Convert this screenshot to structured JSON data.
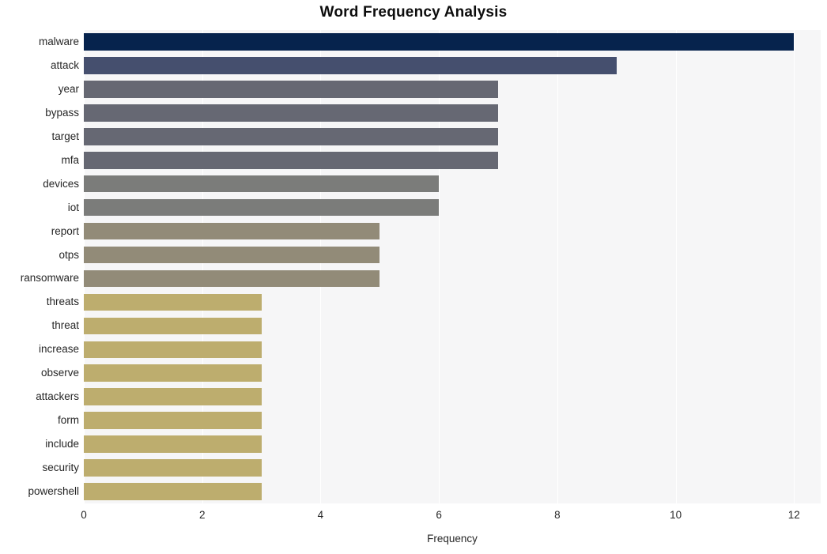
{
  "chart_data": {
    "type": "bar",
    "orientation": "horizontal",
    "title": "Word Frequency Analysis",
    "xlabel": "Frequency",
    "ylabel": "",
    "xlim": [
      0,
      12.45
    ],
    "xticks": [
      0,
      2,
      4,
      6,
      8,
      10,
      12
    ],
    "xtick_labels": [
      "0",
      "2",
      "4",
      "6",
      "8",
      "10",
      "12"
    ],
    "grid": "vertical",
    "legend": "none",
    "plot_background": "#f6f6f7",
    "figure_background": "#ffffff",
    "categories": [
      "malware",
      "attack",
      "year",
      "bypass",
      "target",
      "mfa",
      "devices",
      "iot",
      "report",
      "otps",
      "ransomware",
      "threats",
      "threat",
      "increase",
      "observe",
      "attackers",
      "form",
      "include",
      "security",
      "powershell"
    ],
    "values": [
      12,
      9,
      7,
      7,
      7,
      7,
      6,
      6,
      5,
      5,
      5,
      3,
      3,
      3,
      3,
      3,
      3,
      3,
      3,
      3
    ],
    "bar_colors": [
      "#06234d",
      "#454f6e",
      "#666873",
      "#666873",
      "#666873",
      "#666873",
      "#7b7c7a",
      "#7b7c7a",
      "#928b78",
      "#928b78",
      "#928b78",
      "#bdad6e",
      "#bdad6e",
      "#bdad6e",
      "#bdad6e",
      "#bdad6e",
      "#bdad6e",
      "#bdad6e",
      "#bdad6e",
      "#bdad6e"
    ]
  }
}
